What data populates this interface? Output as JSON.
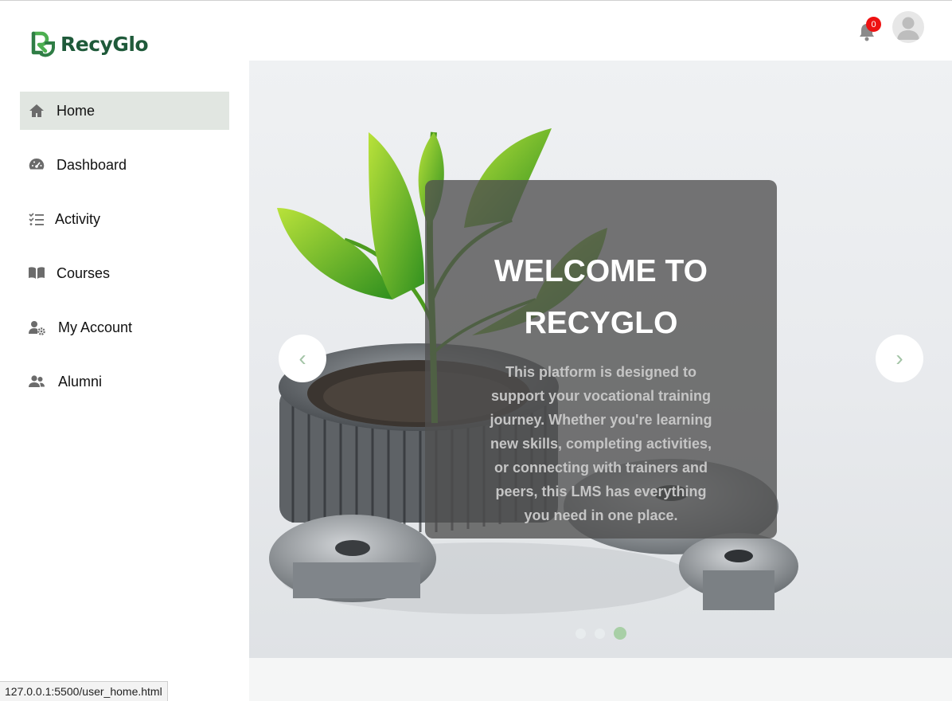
{
  "brand": {
    "name": "RecyGlo",
    "color": "#1f5a3a",
    "accent": "#4caf50"
  },
  "header": {
    "notifications_count": "0"
  },
  "sidebar": {
    "items": [
      {
        "label": "Home",
        "icon": "home-icon",
        "active": true
      },
      {
        "label": "Dashboard",
        "icon": "gauge-icon",
        "active": false
      },
      {
        "label": "Activity",
        "icon": "checklist-icon",
        "active": false
      },
      {
        "label": "Courses",
        "icon": "book-icon",
        "active": false
      },
      {
        "label": "My Account",
        "icon": "user-gear-icon",
        "active": false
      },
      {
        "label": "Alumni",
        "icon": "users-icon",
        "active": false
      }
    ]
  },
  "hero": {
    "title": "WELCOME TO RECYGLO",
    "text": "This platform is designed to support your vocational training journey. Whether you're learning new skills, completing activities, or connecting with trainers and peers, this LMS has everything you need in one place.",
    "prev_arrow": "‹",
    "next_arrow": "›",
    "slides_total": 3,
    "active_slide": 3
  },
  "status": {
    "url": "127.0.0.1:5500/user_home.html"
  }
}
